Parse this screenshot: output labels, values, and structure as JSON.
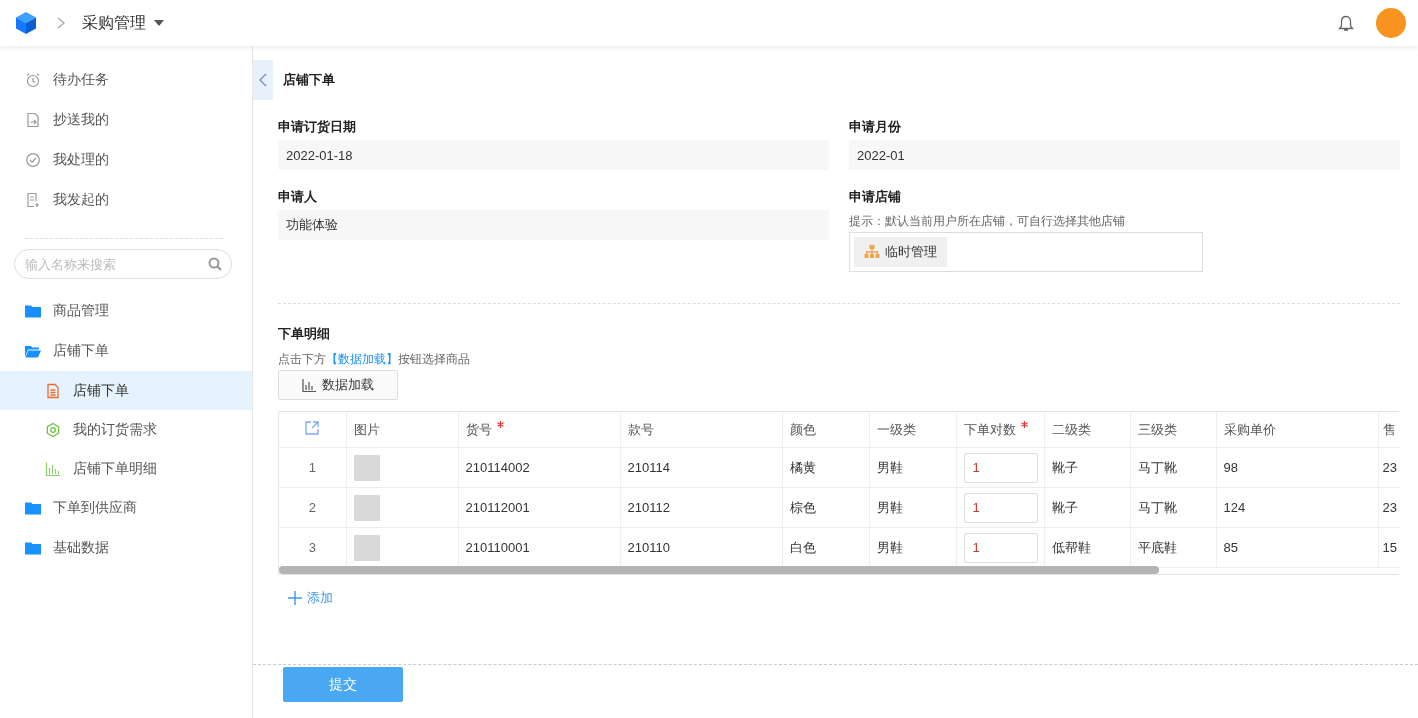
{
  "header": {
    "title": "采购管理"
  },
  "sidebar": {
    "quick_items": [
      {
        "label": "待办任务",
        "kind": "alarm"
      },
      {
        "label": "抄送我的",
        "kind": "forward"
      },
      {
        "label": "我处理的",
        "kind": "check"
      },
      {
        "label": "我发起的",
        "kind": "create"
      }
    ],
    "search": {
      "placeholder": "输入名称来搜索"
    },
    "tree": [
      {
        "label": "商品管理",
        "expanded": false
      },
      {
        "label": "店铺下单",
        "expanded": true,
        "children": [
          {
            "label": "店铺下单",
            "kind": "document",
            "selected": true
          },
          {
            "label": "我的订货需求",
            "kind": "target",
            "selected": false
          },
          {
            "label": "店铺下单明细",
            "kind": "chart",
            "selected": false
          }
        ]
      },
      {
        "label": "下单到供应商",
        "expanded": false
      },
      {
        "label": "基础数据",
        "expanded": false
      }
    ]
  },
  "page": {
    "title": "店铺下单",
    "fields": [
      {
        "label": "申请订货日期",
        "kind": "text",
        "value": "2022-01-18"
      },
      {
        "label": "申请月份",
        "kind": "text",
        "value": "2022-01"
      },
      {
        "label": "申请人",
        "kind": "text",
        "value": "功能体验"
      },
      {
        "label": "申请店铺",
        "kind": "store",
        "hint": "提示：默认当前用户所在店铺，可自行选择其他店铺",
        "value": "临时管理"
      }
    ],
    "details": {
      "title": "下单明细",
      "hint": {
        "before": "点击下方",
        "link": "【数据加载】",
        "after": "按钮选择商品"
      },
      "load_button": "数据加载",
      "table": {
        "columns": [
          {
            "label": "图片",
            "kind": "photo",
            "required": false
          },
          {
            "label": "货号",
            "kind": "text",
            "required": true
          },
          {
            "label": "款号",
            "kind": "text",
            "required": false
          },
          {
            "label": "颜色",
            "kind": "text",
            "required": false
          },
          {
            "label": "一级类",
            "kind": "text",
            "required": false
          },
          {
            "label": "下单对数",
            "kind": "input",
            "required": true
          },
          {
            "label": "二级类",
            "kind": "text",
            "required": false
          },
          {
            "label": "三级类",
            "kind": "text",
            "required": false
          },
          {
            "label": "采购单价",
            "kind": "text",
            "required": false
          },
          {
            "label": "售",
            "kind": "text"
          }
        ],
        "rows": [
          {
            "index": "1",
            "values": [
              "210114002",
              "210114",
              "橘黄",
              "男鞋",
              "1",
              "靴子",
              "马丁靴",
              "98",
              "23"
            ]
          },
          {
            "index": "2",
            "values": [
              "210112001",
              "210112",
              "棕色",
              "男鞋",
              "1",
              "靴子",
              "马丁靴",
              "124",
              "23"
            ]
          },
          {
            "index": "3",
            "values": [
              "210110001",
              "210110",
              "白色",
              "男鞋",
              "1",
              "低帮鞋",
              "平底鞋",
              "85",
              "15"
            ]
          }
        ]
      },
      "add_button": "添加"
    },
    "submit_button": "提交"
  }
}
